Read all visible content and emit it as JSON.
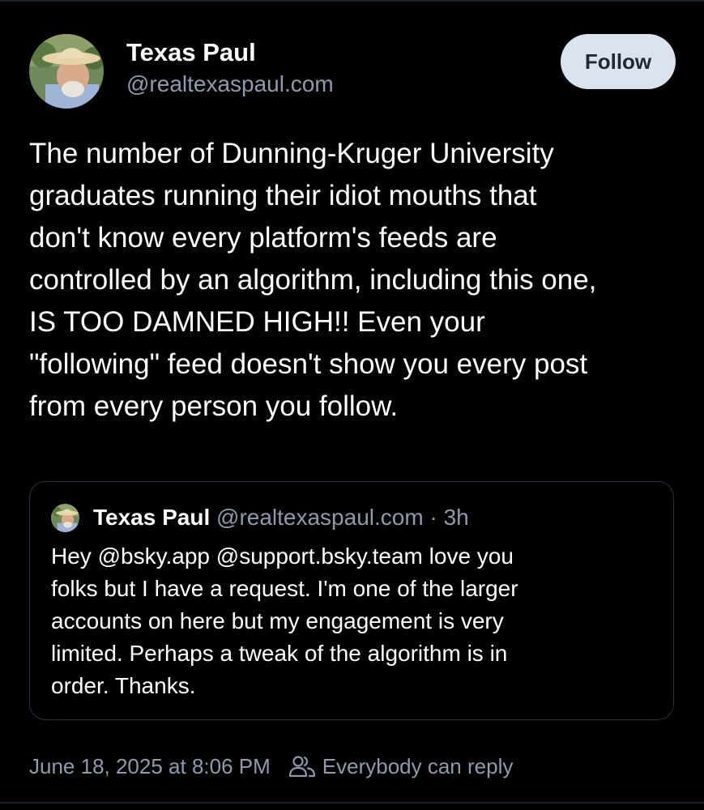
{
  "post": {
    "author": {
      "display_name": "Texas Paul",
      "handle": "@realtexaspaul.com"
    },
    "follow_label": "Follow",
    "text": "The number of Dunning-Kruger University\ngraduates running their idiot mouths that\ndon't know every platform's feeds are\ncontrolled by an algorithm, including this one,\nIS TOO DAMNED HIGH!!  Even your\n\"following\" feed doesn't show you every post\nfrom every person you follow.",
    "quote": {
      "display_name": "Texas Paul",
      "handle": "@realtexaspaul.com",
      "separator": "·",
      "time": "3h",
      "text": "Hey @bsky.app @support.bsky.team love you\nfolks but I have a request.  I'm one of the larger\naccounts on here but my engagement is very\nlimited.  Perhaps a tweak of the algorithm is in\norder.  Thanks."
    },
    "timestamp": "June 18, 2025 at 8:06 PM",
    "reply_setting": "Everybody can reply"
  },
  "icons": {
    "people": "people-icon"
  },
  "colors": {
    "background": "#000000",
    "text": "#ffffff",
    "muted": "#8f9bad",
    "follow_button_bg": "#dbe3ee",
    "quote_border": "#2a313d"
  }
}
